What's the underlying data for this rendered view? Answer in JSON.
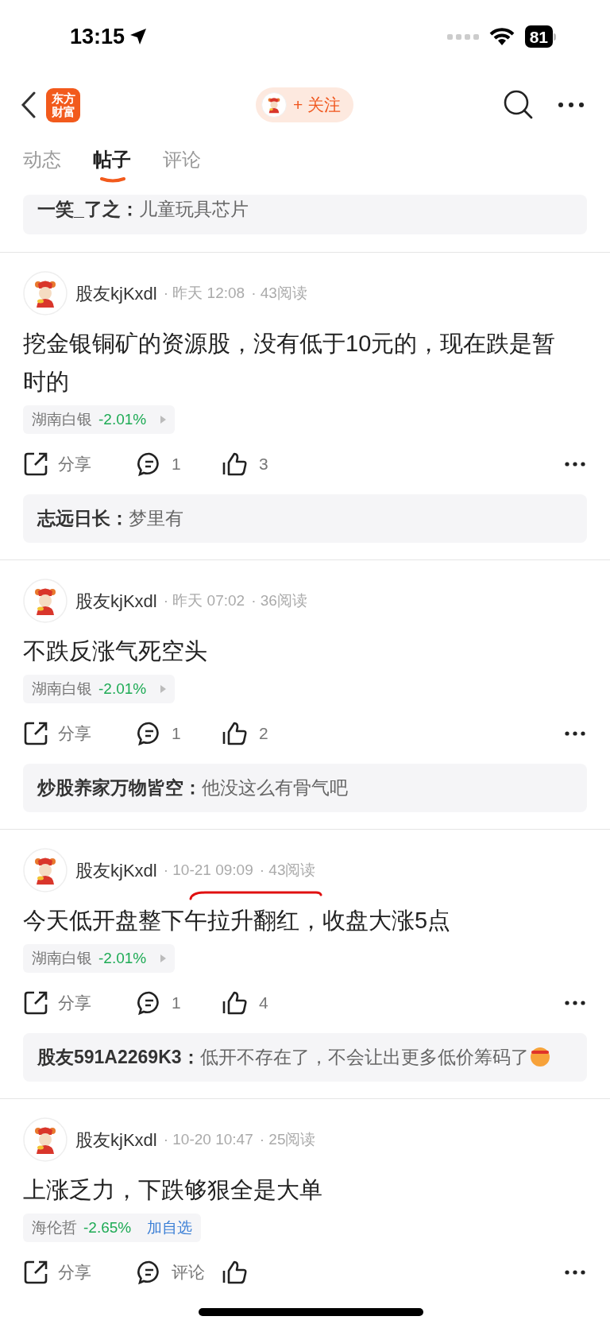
{
  "status_bar": {
    "time": "13:15",
    "battery": "81"
  },
  "header": {
    "logo": [
      "东方",
      "财富"
    ],
    "follow_button": "+ 关注"
  },
  "tabs": [
    {
      "label": "动态",
      "selected": false
    },
    {
      "label": "帖子",
      "selected": true
    },
    {
      "label": "评论",
      "selected": false
    }
  ],
  "top_comment": {
    "author": "一笑_了之：",
    "text": "儿童玩具芯片"
  },
  "posts": [
    {
      "author": "股友kjKxdl",
      "time": "· 昨天 12:08",
      "reads": "· 43阅读",
      "body": "挖金银铜矿的资源股，没有低于10元的，现在跌是暂时的",
      "stock": {
        "name": "湖南白银",
        "change": "-2.01%",
        "color": "#1eab55"
      },
      "actions": {
        "share": "分享",
        "comment": "1",
        "like": "3"
      },
      "comment": {
        "author": "志远日长：",
        "text": "梦里有"
      }
    },
    {
      "author": "股友kjKxdl",
      "time": "· 昨天 07:02",
      "reads": "· 36阅读",
      "body": "不跌反涨气死空头",
      "stock": {
        "name": "湖南白银",
        "change": "-2.01%",
        "color": "#1eab55"
      },
      "actions": {
        "share": "分享",
        "comment": "1",
        "like": "2"
      },
      "comment": {
        "author": "炒股养家万物皆空：",
        "text": "他没这么有骨气吧"
      }
    },
    {
      "author": "股友kjKxdl",
      "time": "· 10-21 09:09",
      "reads": "· 43阅读",
      "time_marked": true,
      "body": "今天低开盘整下午拉升翻红，收盘大涨5点",
      "stock": {
        "name": "湖南白银",
        "change": "-2.01%",
        "color": "#1eab55"
      },
      "actions": {
        "share": "分享",
        "comment": "1",
        "like": "4"
      },
      "comment": {
        "author": "股友591A2269K3：",
        "text": "低开不存在了，不会让出更多低价筹码了",
        "emoji": true
      }
    },
    {
      "author": "股友kjKxdl",
      "time": "· 10-20 10:47",
      "reads": "· 25阅读",
      "body": "上涨乏力，下跌够狠全是大单",
      "stock": {
        "name": "海伦哲",
        "change": "-2.65%",
        "color": "#1eab55",
        "add_button": "加自选"
      },
      "actions": {
        "share": "分享",
        "comment": "评论"
      }
    }
  ]
}
